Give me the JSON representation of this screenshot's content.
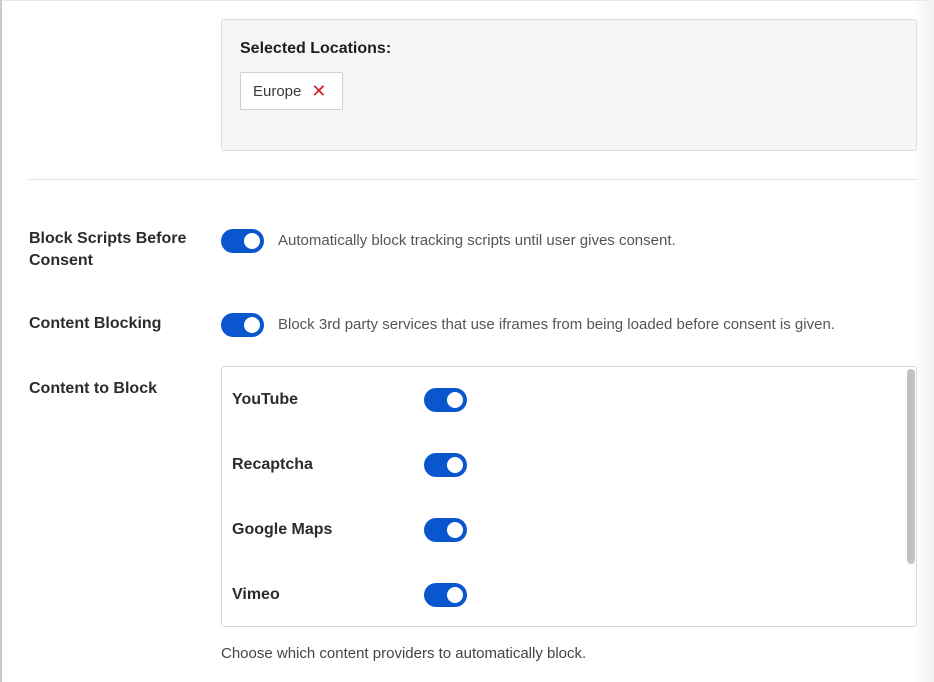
{
  "locations": {
    "title": "Selected Locations:",
    "selected": [
      {
        "name": "Europe",
        "remove_icon": "close-icon"
      }
    ]
  },
  "settings": {
    "block_scripts": {
      "label": "Block Scripts Before Consent",
      "description": "Automatically block tracking scripts until user gives consent.",
      "enabled": true
    },
    "content_blocking": {
      "label": "Content Blocking",
      "description": "Block 3rd party services that use iframes from being loaded before consent is given.",
      "enabled": true
    },
    "content_to_block": {
      "label": "Content to Block",
      "providers": [
        {
          "name": "YouTube",
          "enabled": true
        },
        {
          "name": "Recaptcha",
          "enabled": true
        },
        {
          "name": "Google Maps",
          "enabled": true
        },
        {
          "name": "Vimeo",
          "enabled": true
        }
      ],
      "help": "Choose which content providers to automatically block."
    }
  },
  "colors": {
    "toggle_on": "#0a56cf",
    "remove_icon": "#d0202a"
  }
}
